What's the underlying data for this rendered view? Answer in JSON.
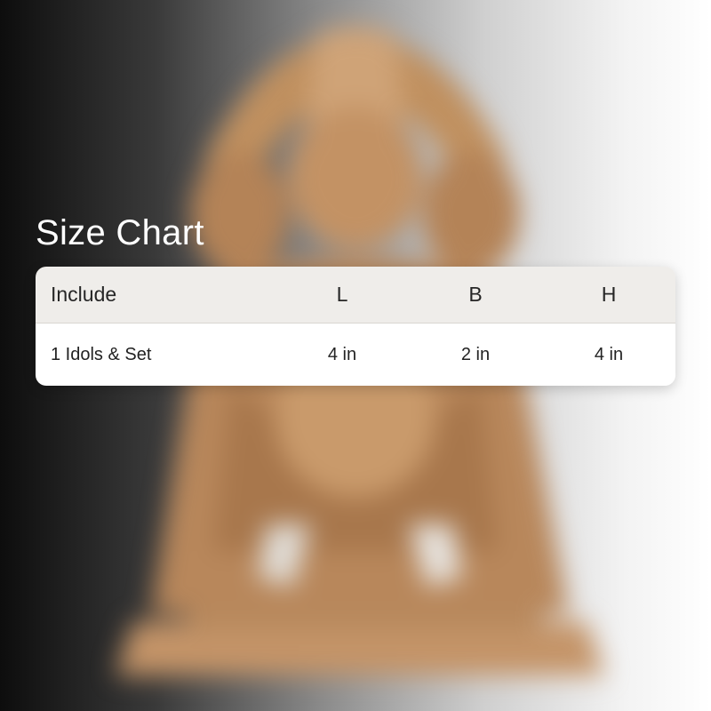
{
  "title": "Size Chart",
  "table": {
    "headers": {
      "name": "Include",
      "l": "L",
      "b": "B",
      "h": "H"
    },
    "rows": [
      {
        "name": "1 Idols & Set",
        "l": "4 in",
        "b": "2 in",
        "h": "4 in"
      }
    ]
  },
  "colors": {
    "header_bg": "#efedea",
    "row_bg": "#ffffff",
    "title_color": "#ffffff",
    "statue_color": "#b9865a"
  }
}
